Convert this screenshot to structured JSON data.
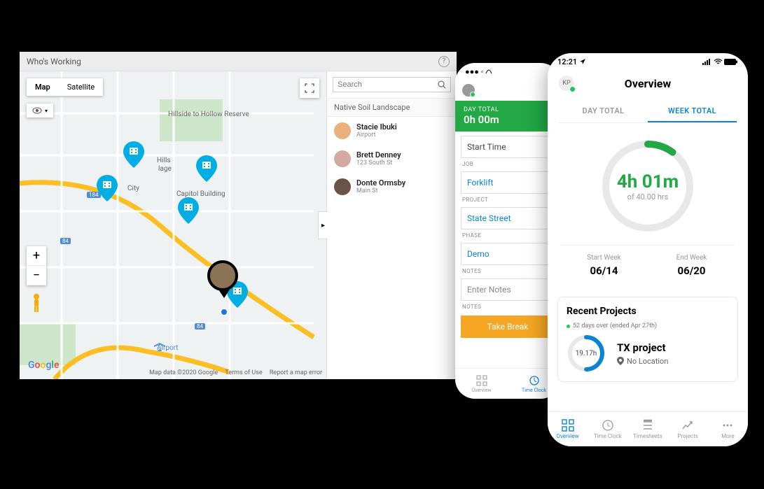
{
  "desktop": {
    "title": "Who's Working",
    "map_tabs": [
      "Map",
      "Satellite"
    ],
    "labels": {
      "hillside": "Hillside to Hollow Reserve",
      "capitol": "Capitol Building",
      "airport": "Airport",
      "city_suffix": "City",
      "hills": "Hills",
      "lage": "lage",
      "hwy184": "184",
      "hwy84a": "84",
      "hwy84b": "84"
    },
    "attribution": {
      "data": "Map data ©2020 Google",
      "terms": "Terms of Use",
      "report": "Report a map error"
    },
    "search": {
      "placeholder": "Search"
    },
    "group": "Native Soil Landscape",
    "workers": [
      {
        "name": "Stacie Ibuki",
        "loc": "Airport",
        "avatar_bg": "#e8b07a"
      },
      {
        "name": "Brett Denney",
        "loc": "123 South St",
        "avatar_bg": "#d4a9a0"
      },
      {
        "name": "Donte Ormsby",
        "loc": "Main St",
        "avatar_bg": "#6b5444"
      }
    ]
  },
  "phone1": {
    "day_total_label": "DAY TOTAL",
    "day_total_value": "0h 00m",
    "start_time": "Start Time",
    "sections": {
      "job": "JOB",
      "project": "PROJECT",
      "phase": "PHASE",
      "notes": "NOTES",
      "notes2": "NOTES"
    },
    "job": "Forklift",
    "project": "State Street",
    "phase": "Demo",
    "notes": "Enter Notes",
    "take_break": "Take Break",
    "nav": [
      "Overview",
      "Time Clock"
    ]
  },
  "phone2": {
    "time": "12:21",
    "avatar": "KP",
    "title": "Overview",
    "tabs": [
      "DAY TOTAL",
      "WEEK TOTAL"
    ],
    "hours": "4h 01m",
    "of": "of 40.00 hrs",
    "week_start_label": "Start Week",
    "week_start": "06/14",
    "week_end_label": "End Week",
    "week_end": "06/20",
    "recent_hdr": "Recent Projects",
    "over_days": "52 days over (ended Apr 27th)",
    "proj_hours": "19.17h",
    "proj_name": "TX  project",
    "proj_loc": "No Location",
    "nav": [
      "Overview",
      "Time Clock",
      "Timesheets",
      "Projects",
      "More"
    ]
  }
}
